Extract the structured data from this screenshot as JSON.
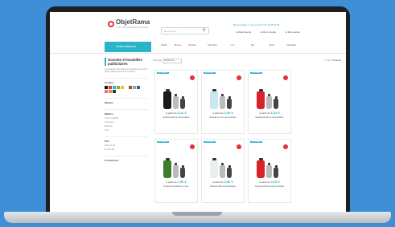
{
  "header": {
    "logo": "ObjetRama",
    "tagline": "Votre objet publicitaire personnalisé",
    "search_placeholder": "Rechercher",
    "promo": "Besoin d'aide ou de conseils ? 01 23 45 67 89",
    "links": [
      "Mes favoris",
      "Mon compte",
      "Mon panier"
    ]
  },
  "nav": {
    "categories_button": "Toutes catégories",
    "menu": [
      "Textile",
      "Bureau",
      "Goodies",
      "High-Tech",
      "Sacs",
      "Eté",
      "Écolo",
      "Ustensiles"
    ]
  },
  "sidebar": {
    "title": "Gourdes et bouteilles publicitaires",
    "description": "Les gourdes et bouteilles personnalisées sont des objets pratiques à offrir à vos clients.",
    "filters": [
      "Couleur",
      "Marque",
      "Matière",
      "Prix",
      "Contenance"
    ],
    "options": [
      "Acier inoxydable",
      "Aluminium",
      "Plastique",
      "Verre",
      "Moins de 1€",
      "De 1€ à 5€"
    ],
    "colors": [
      "#111111",
      "#e2313b",
      "#2ab3c9",
      "#7bb242",
      "#f0c419",
      "#ffffff",
      "#8a5a2b",
      "#a0a0a0",
      "#2f5fa8",
      "#e26ea8",
      "#f28c28",
      "#333333"
    ]
  },
  "toolbar": {
    "sort_label": "Trier par",
    "sort_value": "Pertinence",
    "pages": "< 1 2 >",
    "page_label": "Produits"
  },
  "products": [
    {
      "badge": "NOUVEAU",
      "price": "5,12 €",
      "name": "Gourde isotherme personnalisée",
      "bottle_color": "#1a1a1a"
    },
    {
      "badge": "NOUVEAU",
      "price": "3,90 €",
      "name": "Bouteille en verre personnalisée",
      "bottle_color": "#c9e7ef"
    },
    {
      "badge": "NOUVEAU",
      "price": "6,25 €",
      "name": "Bouteille aluminium personnalisée",
      "bottle_color": "#d8232a"
    },
    {
      "badge": "NOUVEAU",
      "price": "7,50 €",
      "name": "Bouteille sérigraphiée en verre",
      "bottle_color": "#3e7d2a"
    },
    {
      "badge": "NOUVEAU",
      "price": "2,80 €",
      "name": "Bouteille tritan personnalisable",
      "bottle_color": "#e9eef0"
    },
    {
      "badge": "NOUVEAU",
      "price": "4,15 €",
      "name": "Gourde aluminium rouge publicitaire",
      "bottle_color": "#d8232a"
    }
  ],
  "product_price_prefix": "à partir de"
}
